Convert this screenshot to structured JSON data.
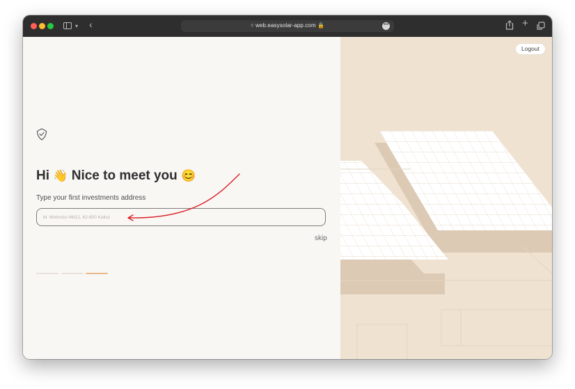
{
  "browser": {
    "url": "web.easysolar-app.com"
  },
  "page": {
    "logout_label": "Logout",
    "greeting": {
      "hi": "Hi",
      "wave_emoji": "👋",
      "text": "Nice to meet you",
      "smile_emoji": "😊"
    },
    "subtitle": "Type your first investments address",
    "address_input": {
      "placeholder": "bl. Wolności 46/12, 62-800 Kalisz",
      "value": ""
    },
    "skip_label": "skip",
    "progress": {
      "total_steps": 3,
      "current_step": 3
    }
  },
  "colors": {
    "accent": "#eab98a",
    "arrow": "#d81f26",
    "illustration_bg": "#efe2d1"
  },
  "icons": {
    "logo": "shield-check-icon"
  }
}
